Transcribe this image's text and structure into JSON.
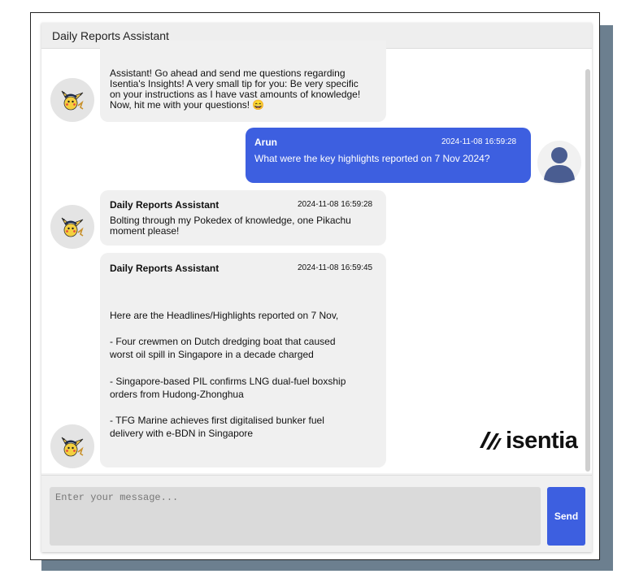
{
  "window": {
    "title": "Daily Reports Assistant"
  },
  "messages": [
    {
      "sender": "bot",
      "lines": [
        "Assistant! Go ahead and send me questions regarding",
        "Isentia's Insights! A very small tip for you: Be very specific",
        "on your instructions as I have vast amounts of knowledge!",
        "Now, hit me with your questions! 😄"
      ]
    },
    {
      "sender": "user",
      "name": "Arun",
      "time": "2024-11-08 16:59:28",
      "text": "What were the key highlights reported on 7 Nov 2024?"
    },
    {
      "sender": "bot",
      "name": "Daily Reports Assistant",
      "time": "2024-11-08 16:59:28",
      "lines": [
        "Bolting through my Pokedex of knowledge, one Pikachu",
        "moment please!"
      ]
    },
    {
      "sender": "bot",
      "name": "Daily Reports Assistant",
      "time": "2024-11-08 16:59:45",
      "lines": [
        "Here are the Headlines/Highlights reported on 7 Nov,",
        "",
        "- Four crewmen on Dutch dredging boat that caused",
        "worst oil spill in Singapore in a decade charged",
        "",
        "- Singapore-based PIL confirms LNG dual-fuel boxship",
        "orders from Hudong-Zhonghua",
        "",
        "- TFG Marine achieves first digitalised bunker fuel",
        "delivery with e-BDN in Singapore"
      ]
    }
  ],
  "brand": {
    "logo_text": "isentia"
  },
  "input": {
    "placeholder": "Enter your message...",
    "value": ""
  },
  "send_button": {
    "label": "Send"
  },
  "colors": {
    "accent": "#3d5fe0",
    "bot_bubble": "#f0f0f0",
    "avatar_bg": "#e4e4e4",
    "user_avatar": "#4a5d91"
  },
  "icons": {
    "bot_avatar": "pikachu-avatar-icon",
    "user_avatar": "user-avatar-icon",
    "logo": "isentia-logo-icon"
  }
}
